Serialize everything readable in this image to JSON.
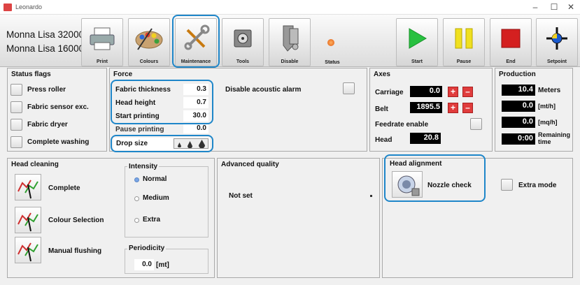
{
  "window": {
    "title": "Leonardo",
    "minimize": "–",
    "maximize": "☐",
    "close": "✕"
  },
  "printers": [
    "Monna Lisa 32000",
    "Monna Lisa 16000"
  ],
  "toolbar": {
    "print": "Print",
    "colours": "Colours",
    "maintenance": "Maintenance",
    "tools": "Tools",
    "disable": "Disable",
    "status": "Status",
    "start": "Start",
    "pause": "Pause",
    "end": "End",
    "setpoint": "Setpoint"
  },
  "status_flags": {
    "title": "Status flags",
    "items": [
      "Press roller",
      "Fabric sensor exc.",
      "Fabric dryer",
      "Complete washing"
    ]
  },
  "force": {
    "title": "Force",
    "fabric_thickness": {
      "label": "Fabric thickness",
      "value": "0.3"
    },
    "head_height": {
      "label": "Head height",
      "value": "0.7"
    },
    "start_printing": {
      "label": "Start printing",
      "value": "30.0"
    },
    "pause_printing": {
      "label": "Pause printing",
      "value": "0.0"
    },
    "drop_size": {
      "label": "Drop size"
    },
    "disable_alarm": "Disable acoustic alarm"
  },
  "axes": {
    "title": "Axes",
    "carriage": {
      "label": "Carriage",
      "value": "0.0"
    },
    "belt": {
      "label": "Belt",
      "value": "1895.5"
    },
    "feedrate": "Feedrate enable",
    "head": {
      "label": "Head",
      "value": "20.8"
    },
    "plus": "+",
    "minus": "–"
  },
  "production": {
    "title": "Production",
    "rows": [
      {
        "value": "10.4",
        "unit": "Meters"
      },
      {
        "value": "0.0",
        "unit": "[mt/h]"
      },
      {
        "value": "0.0",
        "unit": "[mq/h]"
      },
      {
        "value": "0:00",
        "unit": "Remaining time"
      }
    ]
  },
  "head_cleaning": {
    "title": "Head cleaning",
    "complete": "Complete",
    "colour_selection": "Colour Selection",
    "manual_flushing": "Manual flushing"
  },
  "intensity": {
    "title": "Intensity",
    "normal": "Normal",
    "medium": "Medium",
    "extra": "Extra"
  },
  "periodicity": {
    "title": "Periodicity",
    "value": "0.0",
    "unit": "[mt]"
  },
  "advanced_quality": {
    "title": "Advanced quality",
    "selected": "Not set"
  },
  "head_alignment": {
    "title": "Head alignment",
    "nozzle_check": "Nozzle check"
  },
  "extra_mode": "Extra mode"
}
